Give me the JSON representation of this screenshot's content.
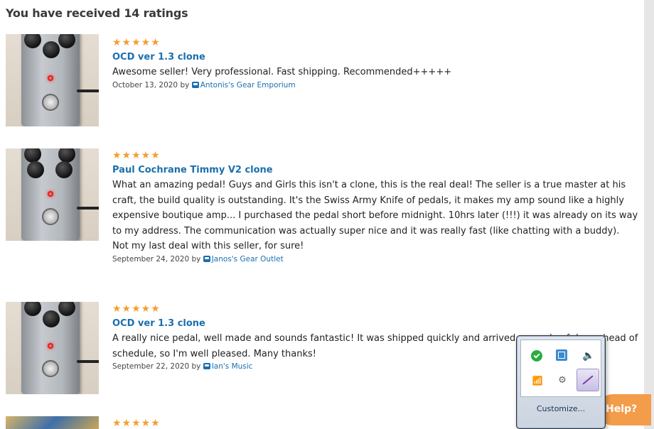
{
  "page": {
    "title": "You have received 14 ratings"
  },
  "reviews": [
    {
      "stars": "★★★★★",
      "product": "OCD ver 1.3 clone",
      "text": "Awesome seller! Very professional. Fast shipping. Recommended+++++",
      "date_by": "October 13, 2020 by",
      "store": "Antonis's Gear Emporium"
    },
    {
      "stars": "★★★★★",
      "product": "Paul Cochrane Timmy V2 clone",
      "text": "What an amazing pedal! Guys and Girls this isn't a clone, this is the real deal! The seller is a true master at his craft, the build quality is outstanding. It's the Swiss Army Knife of pedals, it makes my amp sound like a highly expensive boutique amp... I purchased the pedal short before midnight. 10hrs later (!!!) it was already on its way to my address. The communication was actually super nice and it was really fast (like chatting with a buddy). Not my last deal with this seller, for sure!",
      "date_by": "September 24, 2020 by",
      "store": "Janos's Gear Outlet"
    },
    {
      "stars": "★★★★★",
      "product": "OCD ver 1.3 clone",
      "text": "A really nice pedal, well made and sounds fantastic! It was shipped quickly and arrived a couple of days ahead of schedule, so I'm well pleased. Many thanks!",
      "date_by": "September 22, 2020 by",
      "store": "Ian's Music"
    },
    {
      "stars": "★★★★★"
    }
  ],
  "help": {
    "label": "Help?"
  },
  "tray": {
    "customize_label": "Customize...",
    "icons": [
      "shield-check-icon",
      "app-window-icon",
      "speaker-icon",
      "signal-bars-icon",
      "network-icon",
      "pen-tablet-icon"
    ],
    "glyphs": {
      "speaker": "🔈",
      "signal": "📶",
      "net": "⚙"
    }
  },
  "colors": {
    "link": "#1b6fae",
    "stars": "#f0a030",
    "help_button": "#f39c4a"
  }
}
